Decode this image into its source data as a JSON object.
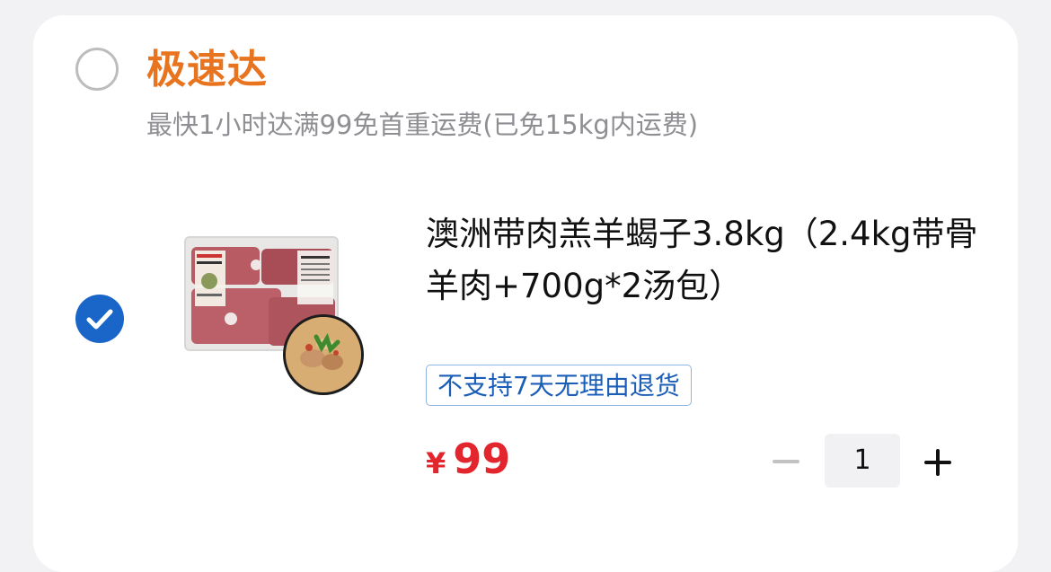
{
  "store": {
    "name": "极速达",
    "subtitle": "最快1小时达满99免首重运费(已免15kg内运费)",
    "selected": false
  },
  "item": {
    "selected": true,
    "title": "澳洲带肉羔羊蝎子3.8kg（2.4kg带骨羊肉+700g*2汤包）",
    "return_tag": "不支持7天无理由退货",
    "price_symbol": "¥",
    "price": "99",
    "quantity": "1"
  },
  "icons": {
    "store_radio": "radio-unchecked-icon",
    "item_check": "checkmark-circle-icon",
    "minus": "minus-icon",
    "plus": "plus-icon"
  },
  "colors": {
    "store_title": "#e8741f",
    "checkbox": "#1a66c8",
    "price": "#e3262e",
    "tag_text": "#1a5eb7",
    "tag_border": "#8fb3df"
  }
}
